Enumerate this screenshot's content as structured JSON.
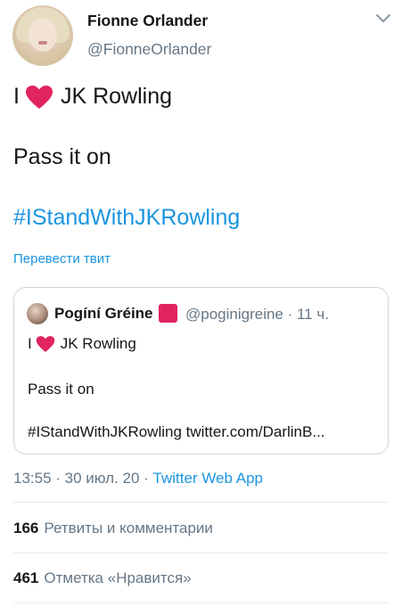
{
  "author": {
    "display_name": "Fionne Orlander",
    "handle": "@FionneOrlander"
  },
  "tweet": {
    "line1_prefix": "I",
    "line1_suffix": "JK Rowling",
    "line2": "Pass it on",
    "hashtag": "#IStandWithJKRowling",
    "translate_link": "Перевести твит"
  },
  "quoted_tweet": {
    "display_name": "Pogíní Gréine",
    "handle_time": "@poginigreine · 11 ч.",
    "line1_prefix": "I",
    "line1_suffix": "JK Rowling",
    "line2": "Pass it on",
    "line3": "#IStandWithJKRowling twitter.com/DarlinB..."
  },
  "meta": {
    "timestamp": "13:55 · 30 июл. 20 · ",
    "source": "Twitter Web App"
  },
  "stats": {
    "retweets_count": "166",
    "retweets_label": "Ретвиты и комментарии",
    "likes_count": "461",
    "likes_label": "Отметка «Нравится»"
  },
  "colors": {
    "accent": "#1b95e0",
    "heart": "#e0245e",
    "secondary_text": "#657786"
  }
}
